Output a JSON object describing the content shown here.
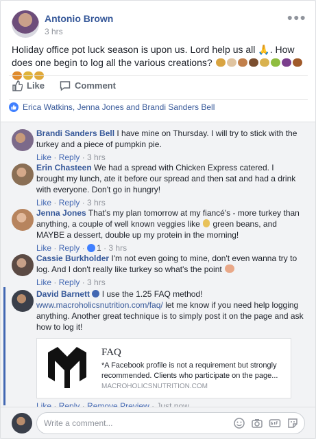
{
  "post": {
    "author": "Antonio Brown",
    "time": "3 hrs",
    "text": "Holiday office pot luck season is upon us. Lord help us all 🙏. How does one begin to log all the various creations?",
    "emojis": [
      "#d9a441",
      "#e0c4a0",
      "#c17f4a",
      "#7b4e2f",
      "#d9b24f",
      "#8fbd3f",
      "#7a3e8c",
      "#a05a2a",
      "#e08b2c",
      "#e0b43a",
      "#e0a93a"
    ]
  },
  "actions": {
    "like": "Like",
    "comment": "Comment"
  },
  "reactions": {
    "names": "Erica Watkins, Jenna Jones and Brandi Sanders Bell"
  },
  "comments": [
    {
      "name": "Brandi Sanders Bell",
      "text": "I have mine on Thursday. I will try to stick with the turkey and a piece of pumpkin pie.",
      "like": "Like",
      "reply": "Reply",
      "time": "3 hrs"
    },
    {
      "name": "Erin Chasteen",
      "text": "We had a spread with Chicken Express catered. I brought my lunch, ate it before our spread and then sat and had a drink with everyone. Don't go in hungry!",
      "like": "Like",
      "reply": "Reply",
      "time": "3 hrs"
    },
    {
      "name": "Jenna Jones",
      "text_a": "That's my plan tomorrow at my fiancé's - more turkey than anything, a couple of well known veggies like",
      "text_b": "green beans, and MAYBE a dessert, double up my protein in the morning!",
      "like": "Like",
      "reply": "Reply",
      "reactions": "1",
      "time": "3 hrs"
    },
    {
      "name": "Cassie Burkholder",
      "text": "I'm not even going to mine, don't even wanna try to log. And I don't really like turkey so what's the point",
      "like": "Like",
      "reply": "Reply",
      "time": "3 hrs"
    },
    {
      "name": "David Barnett",
      "text": "I use the 1.25 FAQ method!",
      "url": "www.macroholicsnutrition.com/faq/",
      "text2": "let me know if you need help logging anything. Another great technique is to simply post it on the page and ask how to log it!",
      "like": "Like",
      "reply": "Reply",
      "remove_preview": "Remove Preview",
      "time": "Just now",
      "preview": {
        "title": "FAQ",
        "description": "*A Facebook profile is not a requirement but strongly recommended. Clients who participate on the page...",
        "domain": "MACROHOLICSNUTRITION.COM"
      }
    }
  ],
  "composer": {
    "placeholder": "Write a comment..."
  },
  "colors": {
    "link": "#365899",
    "accent": "#4267b2"
  }
}
